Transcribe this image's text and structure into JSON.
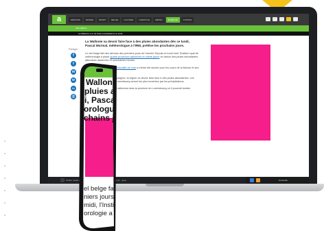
{
  "site": {
    "logo_text": "a",
    "nav_items": [
      "RÉGIONS",
      "MONDE",
      "SPORT",
      "BELGE",
      "CULTURE",
      "LIFESTYLE",
      "MÉTÉO",
      "MOBILITÉ",
      "JUSTICE"
    ],
    "active_nav_index": 7,
    "breadcrumb": "Informations",
    "alert_text": "La Wallonie a vu de fortes précipitations ce lundi"
  },
  "share": {
    "label": "Partager",
    "buttons": [
      {
        "icon": "facebook-icon",
        "glyph": "f",
        "color": "#1a73b8"
      },
      {
        "icon": "twitter-icon",
        "glyph": "t",
        "color": "#1a73b8"
      },
      {
        "icon": "messenger-icon",
        "glyph": "m",
        "color": "#1a73b8"
      },
      {
        "icon": "whatsapp-icon",
        "glyph": "w",
        "color": "#1a73b8"
      },
      {
        "icon": "linkedin-icon",
        "glyph": "in",
        "color": "#1a73b8"
      },
      {
        "icon": "email-icon",
        "glyph": "@",
        "color": "#1a73b8"
      }
    ]
  },
  "article": {
    "title": "La Wallonie va devoir faire face à des pluies abondantes dès ce lundi, Pascal Mormal, météorologue à l'IRM, prélève les prochains jours.",
    "p1": "Le ciel belge fait des siennes des premiers jours de l'année! Depuis ce lundi midi, l'Institut royal de météorologie a placé",
    "p1_link": "quatre provinces wallonnes en alerte jaune",
    "p1_end": "en raison des pluies abondantes attendues durant les 24 prochaines heures.",
    "p2": "En début d'après-midi,",
    "p2_link": "une actualité de crue",
    "p2_end": "a même été lancée pour les cours de la Meuse et ses affluents.",
    "p3": "Les pluies qui devraient s'épargner, la région va devoir faire face à des pluies abondantes. Les provinces de Namur et de Luxembourg seront les plus touchées par les précipitations.",
    "p4": "Des cumuls importants sont attendus dans la province du Luxembourg où il pourrait tomber jusqu'à 70 mm."
  },
  "phone": {
    "title_lines": [
      "Wallonie va devoir faire face",
      "pluies abondantes dès ce",
      "i, Pascal Mormal,",
      "orologue à l'IRM, préface le",
      "chains jours."
    ],
    "body_lines": [
      "el belge fait des siennes dès",
      "niers jours de l'année! Depuis",
      "midi, l'Institut royal de"
    ],
    "body_last_prefix": "orologie a placé",
    "body_last_link": "quatre"
  },
  "downloads": {
    "file1": "Fichier media (1) ...jpeg",
    "file2": "Fichier media (2) ...jpeg"
  },
  "taskbar": {
    "status": "Connecté"
  },
  "colors": {
    "accent_green": "#69c23a",
    "ad_pink": "#f51e8a",
    "brand_yellow": "#f5c21b",
    "link_blue": "#1f6fb5"
  }
}
